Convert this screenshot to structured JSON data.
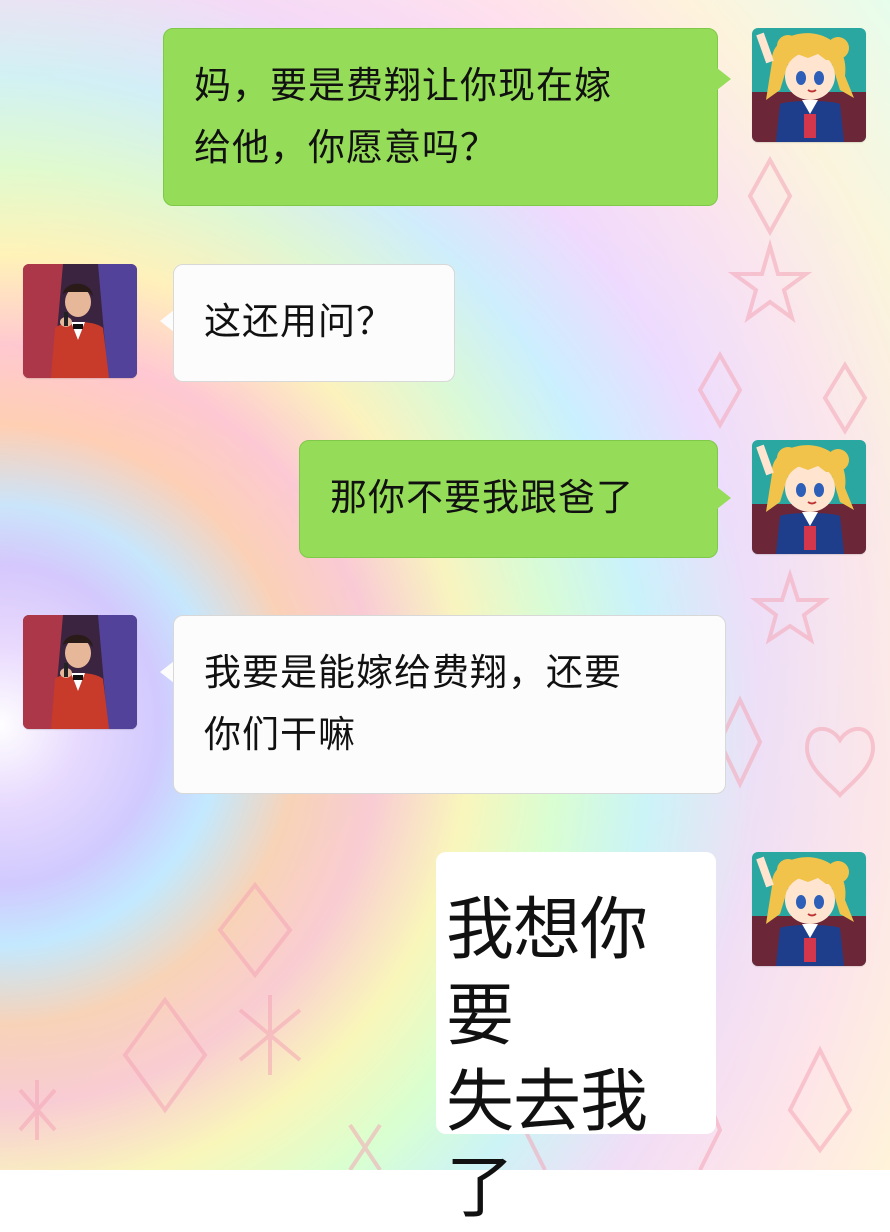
{
  "chat": {
    "messages": [
      {
        "side": "right",
        "speaker": "me",
        "text": "妈，要是费翔让你现在嫁\n给他，你愿意吗？"
      },
      {
        "side": "left",
        "speaker": "mom",
        "text": "这还用问？"
      },
      {
        "side": "right",
        "speaker": "me",
        "text": "那你不要我跟爸了"
      },
      {
        "side": "left",
        "speaker": "mom",
        "text": "我要是能嫁给费翔，还要\n你们干嘛"
      },
      {
        "side": "right",
        "speaker": "me",
        "kind": "sticker",
        "text": "我想你要\n失去我了"
      }
    ]
  },
  "colors": {
    "sent_bubble": "#95dc58",
    "received_bubble": "#fcfcfc"
  },
  "icons": {
    "me_avatar": "anime-girl-avatar",
    "mom_avatar": "singer-avatar"
  }
}
